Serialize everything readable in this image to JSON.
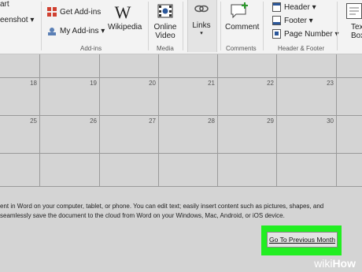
{
  "ribbon": {
    "screenshot_cut": "art",
    "screenshot_label": "eenshot ▾",
    "get_addins": "Get Add-ins",
    "my_addins": "My Add-ins ▾",
    "wikipedia": "Wikipedia",
    "online_video_1": "Online",
    "online_video_2": "Video",
    "links": "Links",
    "links_caret": "▾",
    "comment": "Comment",
    "header": "Header ▾",
    "footer": "Footer ▾",
    "page_number": "Page Number ▾",
    "textbox_1": "Tex",
    "textbox_2": "Box",
    "groups": {
      "addins": "Add-ins",
      "media": "Media",
      "comments": "Comments",
      "header_footer": "Header & Footer"
    }
  },
  "calendar": {
    "row2": [
      "18",
      "19",
      "20",
      "21",
      "22",
      "23"
    ],
    "row3": [
      "25",
      "26",
      "27",
      "28",
      "29",
      "30"
    ]
  },
  "body_text": {
    "line1": "ent in Word on your computer, tablet, or phone. You can edit text; easily insert content such as pictures, shapes, and",
    "line2": "seamlessly save the document to the cloud from Word on your Windows, Mac, Android, or iOS device."
  },
  "go_button": "Go To Previous Month",
  "watermark": {
    "prefix": "wiki",
    "suffix": "How"
  },
  "colors": {
    "highlight": "#22ee22",
    "addins_icon": "#d04030",
    "comment_plus": "#2a9a2a",
    "header_icon": "#2b579a"
  }
}
